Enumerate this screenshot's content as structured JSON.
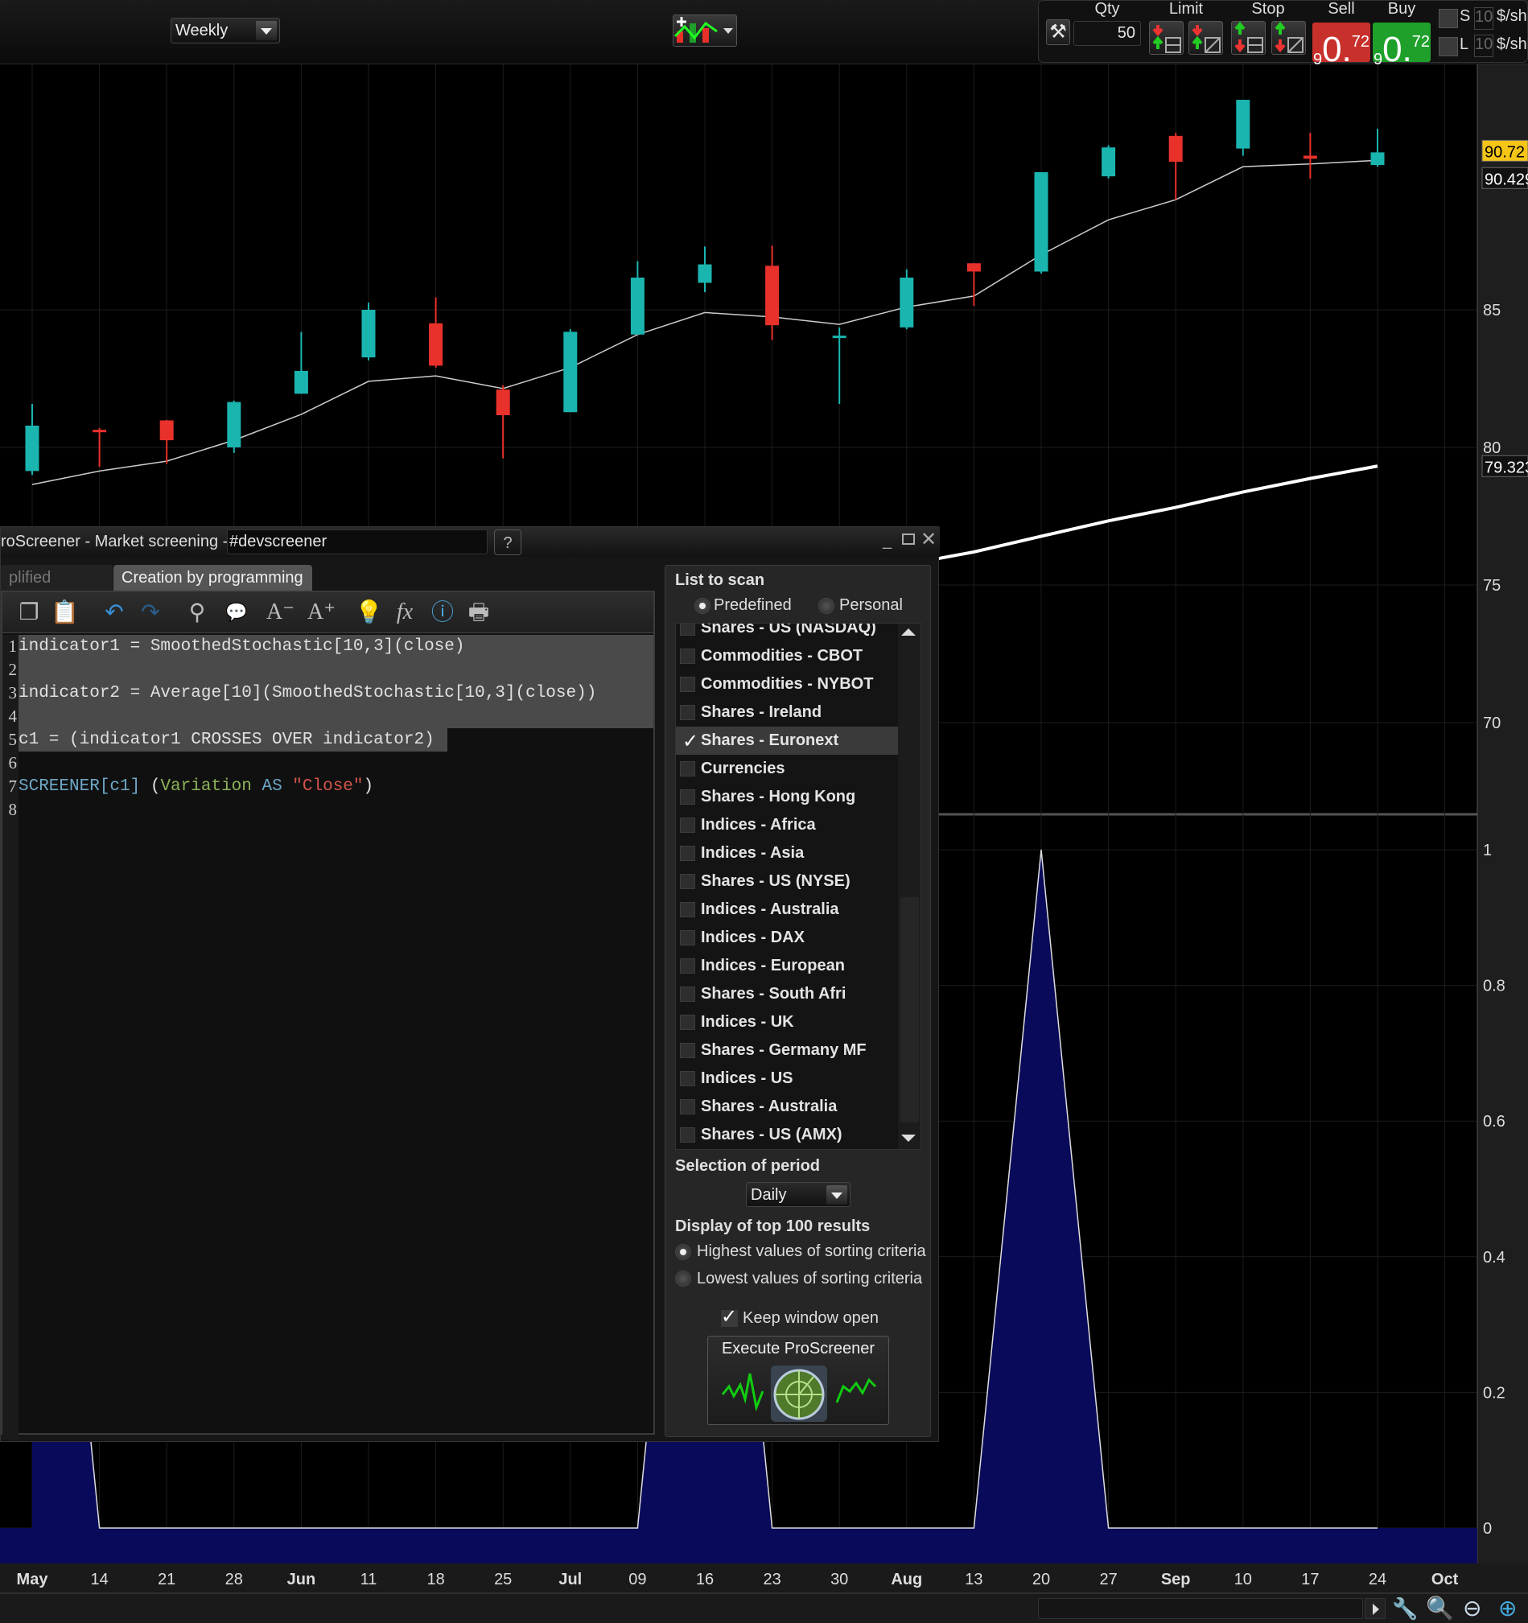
{
  "toolbar": {
    "period": "Weekly",
    "qty_label": "Qty",
    "qty_value": "50",
    "limit_label": "Limit",
    "stop_label": "Stop",
    "sell_label": "Sell",
    "buy_label": "Buy",
    "sell_price": {
      "big": "9",
      "main": "0.",
      "small": "72"
    },
    "buy_price": {
      "big": "9",
      "main": "0.",
      "small": "72"
    },
    "s_label": "S",
    "l_label": "L",
    "s_value": "10",
    "l_value": "10",
    "unit": "$/sh",
    "sell_color": "#c8302c",
    "buy_color": "#1fa02a"
  },
  "dialog": {
    "title": "roScreener - Market screening - ",
    "name_value": "#devscreener",
    "tabs": [
      {
        "label": "plified creation",
        "active": false
      },
      {
        "label": "Creation by programming",
        "active": true
      }
    ],
    "code_lines": [
      [
        {
          "t": "indicator1 = SmoothedStochastic[10,3](close)",
          "c": "#e0e0e0"
        }
      ],
      [],
      [
        {
          "t": "indicator2 = Average[10](SmoothedStochastic[10,3](close))",
          "c": "#e0e0e0"
        }
      ],
      [],
      [
        {
          "t": "c1 = (indicator1 CROSSES OVER indicator2)",
          "c": "#e0e0e0"
        }
      ],
      [],
      [
        {
          "t": "SCREENER[c1]",
          "c": "#6fa8c8"
        },
        {
          "t": " (",
          "c": "#e0e0e0"
        },
        {
          "t": "Variation",
          "c": "#8db35a"
        },
        {
          "t": " AS ",
          "c": "#6fa8c8"
        },
        {
          "t": "\"Close\"",
          "c": "#d4544c"
        },
        {
          "t": ")",
          "c": "#e0e0e0"
        }
      ],
      []
    ],
    "line_numbers": [
      "1",
      "2",
      "3",
      "4",
      "5",
      "6",
      "7",
      "8"
    ],
    "right": {
      "list_title": "List to scan",
      "predefined": "Predefined",
      "personal": "Personal",
      "items": [
        {
          "label": "Shares - US (NASDAQ)",
          "checked": false
        },
        {
          "label": "Commodities - CBOT",
          "checked": false
        },
        {
          "label": "Commodities - NYBOT",
          "checked": false
        },
        {
          "label": "Shares - Ireland",
          "checked": false
        },
        {
          "label": "Shares - Euronext",
          "checked": true
        },
        {
          "label": "Currencies",
          "checked": false
        },
        {
          "label": "Shares - Hong Kong",
          "checked": false
        },
        {
          "label": "Indices - Africa",
          "checked": false
        },
        {
          "label": "Indices - Asia",
          "checked": false
        },
        {
          "label": "Shares - US (NYSE)",
          "checked": false
        },
        {
          "label": "Indices - Australia",
          "checked": false
        },
        {
          "label": "Indices - DAX",
          "checked": false
        },
        {
          "label": "Indices - European",
          "checked": false
        },
        {
          "label": "Shares - South Afri",
          "checked": false
        },
        {
          "label": "Indices - UK",
          "checked": false
        },
        {
          "label": "Shares - Germany MF",
          "checked": false
        },
        {
          "label": "Indices - US",
          "checked": false
        },
        {
          "label": "Shares - Australia",
          "checked": false
        },
        {
          "label": "Shares - US (AMX)",
          "checked": false
        }
      ],
      "period_title": "Selection of period",
      "period_value": "Daily",
      "top_title": "Display of top 100 results",
      "highest": "Highest values of sorting criteria",
      "lowest": "Lowest values of sorting criteria",
      "keep_open": "Keep window open",
      "execute": "Execute ProScreener"
    }
  },
  "chart_data": {
    "type": "candlestick",
    "x_ticks": [
      "May",
      "14",
      "21",
      "28",
      "Jun",
      "11",
      "18",
      "25",
      "Jul",
      "09",
      "16",
      "23",
      "30",
      "Aug",
      "13",
      "20",
      "27",
      "Sep",
      "10",
      "17",
      "24",
      "Oct"
    ],
    "price_ticks": [
      "85",
      "80",
      "75",
      "70"
    ],
    "price_tick_values": [
      85,
      80,
      75,
      70
    ],
    "candles": [
      {
        "o": 79.14,
        "h": 81.58,
        "l": 79.0,
        "c": 80.79
      },
      {
        "o": 80.64,
        "h": 80.7,
        "l": 79.3,
        "c": 80.55
      },
      {
        "o": 80.98,
        "h": 81.0,
        "l": 79.4,
        "c": 80.26
      },
      {
        "o": 80.0,
        "h": 81.7,
        "l": 79.8,
        "c": 81.65
      },
      {
        "o": 81.95,
        "h": 84.2,
        "l": 81.95,
        "c": 82.78
      },
      {
        "o": 83.27,
        "h": 85.26,
        "l": 83.16,
        "c": 85.0
      },
      {
        "o": 84.51,
        "h": 85.45,
        "l": 82.9,
        "c": 82.97
      },
      {
        "o": 82.1,
        "h": 82.26,
        "l": 79.6,
        "c": 81.17
      },
      {
        "o": 81.28,
        "h": 84.3,
        "l": 81.28,
        "c": 84.2
      },
      {
        "o": 84.1,
        "h": 86.77,
        "l": 84.1,
        "c": 86.17
      },
      {
        "o": 85.98,
        "h": 87.3,
        "l": 85.64,
        "c": 86.65
      },
      {
        "o": 86.6,
        "h": 87.33,
        "l": 83.9,
        "c": 84.44
      },
      {
        "o": 84.0,
        "h": 84.36,
        "l": 81.58,
        "c": 84.06
      },
      {
        "o": 84.36,
        "h": 86.47,
        "l": 84.29,
        "c": 86.17
      },
      {
        "o": 86.69,
        "h": 86.69,
        "l": 85.15,
        "c": 86.39
      },
      {
        "o": 86.39,
        "h": 90.0,
        "l": 86.32,
        "c": 90.0
      },
      {
        "o": 89.85,
        "h": 90.98,
        "l": 89.77,
        "c": 90.9
      },
      {
        "o": 91.32,
        "h": 91.43,
        "l": 89.0,
        "c": 90.38
      },
      {
        "o": 90.86,
        "h": 92.63,
        "l": 90.6,
        "c": 92.63
      },
      {
        "o": 90.6,
        "h": 91.43,
        "l": 89.77,
        "c": 90.49
      },
      {
        "o": 90.26,
        "h": 91.58,
        "l": 90.2,
        "c": 90.72
      }
    ],
    "ma_short": [
      78.65,
      79.14,
      79.5,
      80.26,
      81.2,
      82.4,
      82.6,
      82.14,
      82.9,
      84.1,
      84.9,
      84.74,
      84.47,
      85.1,
      85.5,
      87.0,
      88.27,
      89.0,
      90.2,
      90.3,
      90.43
    ],
    "ma_long_start_index": 13,
    "ma_long": [
      75.75,
      76.2,
      76.77,
      77.33,
      77.82,
      78.38,
      78.87,
      79.32
    ],
    "last_price": "90.72",
    "ma_short_last": "90.429",
    "ma_long_last": "79.323",
    "indicator": [
      1,
      0,
      0,
      0,
      0,
      0,
      0,
      0,
      0,
      0,
      1,
      0,
      0,
      0,
      0,
      1,
      0,
      0,
      0,
      0,
      0
    ],
    "indicator_ticks": [
      "1",
      "0.8",
      "0.6",
      "0.4",
      "0.2",
      "0"
    ],
    "indicator_tick_values": [
      1,
      0.8,
      0.6,
      0.4,
      0.2,
      0
    ],
    "colors": {
      "up": "#1bb5b0",
      "down": "#e8312a",
      "indicator_fill": "#0a0a5a",
      "last_price_bg": "#f5c518"
    }
  }
}
